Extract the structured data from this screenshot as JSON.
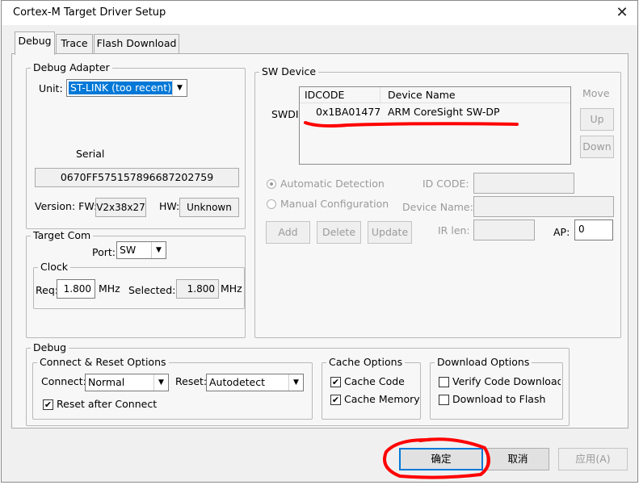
{
  "window": {
    "title": "Cortex-M Target Driver Setup",
    "close_glyph": "✕"
  },
  "tabs": [
    {
      "label": "Debug"
    },
    {
      "label": "Trace"
    },
    {
      "label": "Flash Download"
    }
  ],
  "debug_adapter": {
    "title": "Debug Adapter",
    "unit_label": "Unit:",
    "unit_value": "ST-LINK (too recent)",
    "serial_label": "Serial",
    "serial_value": "0670FF575157896687202759",
    "version_label": "Version: FW:",
    "fw_value": "V2x38x27",
    "hw_label": "HW:",
    "hw_value": "Unknown"
  },
  "target_com": {
    "title": "Target Com",
    "port_label": "Port:",
    "port_value": "SW",
    "clock_title": "Clock",
    "req_label": "Req:",
    "req_value": "1.800",
    "req_unit": "MHz",
    "selected_label": "Selected:",
    "selected_value": "1.800",
    "selected_unit": "MHz"
  },
  "sw_device": {
    "title": "SW Device",
    "swdio_label": "SWDIO",
    "columns": [
      "IDCODE",
      "Device Name"
    ],
    "rows": [
      {
        "idcode": "0x1BA01477",
        "device_name": "ARM CoreSight SW-DP"
      }
    ],
    "move_label": "Move",
    "up_label": "Up",
    "down_label": "Down",
    "auto_detect_label": "Automatic Detection",
    "manual_config_label": "Manual Configuration",
    "id_code_label": "ID CODE:",
    "id_code_value": "",
    "device_name_label": "Device Name:",
    "device_name_value": "",
    "ir_len_label": "IR len:",
    "ir_len_value": "",
    "ap_label": "AP:",
    "ap_value": "0",
    "add_label": "Add",
    "delete_label": "Delete",
    "update_label": "Update"
  },
  "debug_section": {
    "title": "Debug",
    "connect_reset": {
      "title": "Connect & Reset Options",
      "connect_label": "Connect:",
      "connect_value": "Normal",
      "reset_label": "Reset:",
      "reset_value": "Autodetect",
      "reset_after_connect_label": "Reset after Connect",
      "reset_after_connect_checked": true
    },
    "cache_options": {
      "title": "Cache Options",
      "cache_code_label": "Cache Code",
      "cache_code_checked": true,
      "cache_memory_label": "Cache Memory",
      "cache_memory_checked": true
    },
    "download_options": {
      "title": "Download Options",
      "verify_label": "Verify Code Download",
      "verify_checked": false,
      "download_flash_label": "Download to Flash",
      "download_flash_checked": false
    }
  },
  "footer": {
    "ok_label": "确定",
    "cancel_label": "取消",
    "apply_label": "应用(A)"
  },
  "colors": {
    "accent_selection": "#0078d7",
    "annotation_red": "#ff0000"
  },
  "check_glyph": "✔",
  "dropdown_glyph": "▼"
}
